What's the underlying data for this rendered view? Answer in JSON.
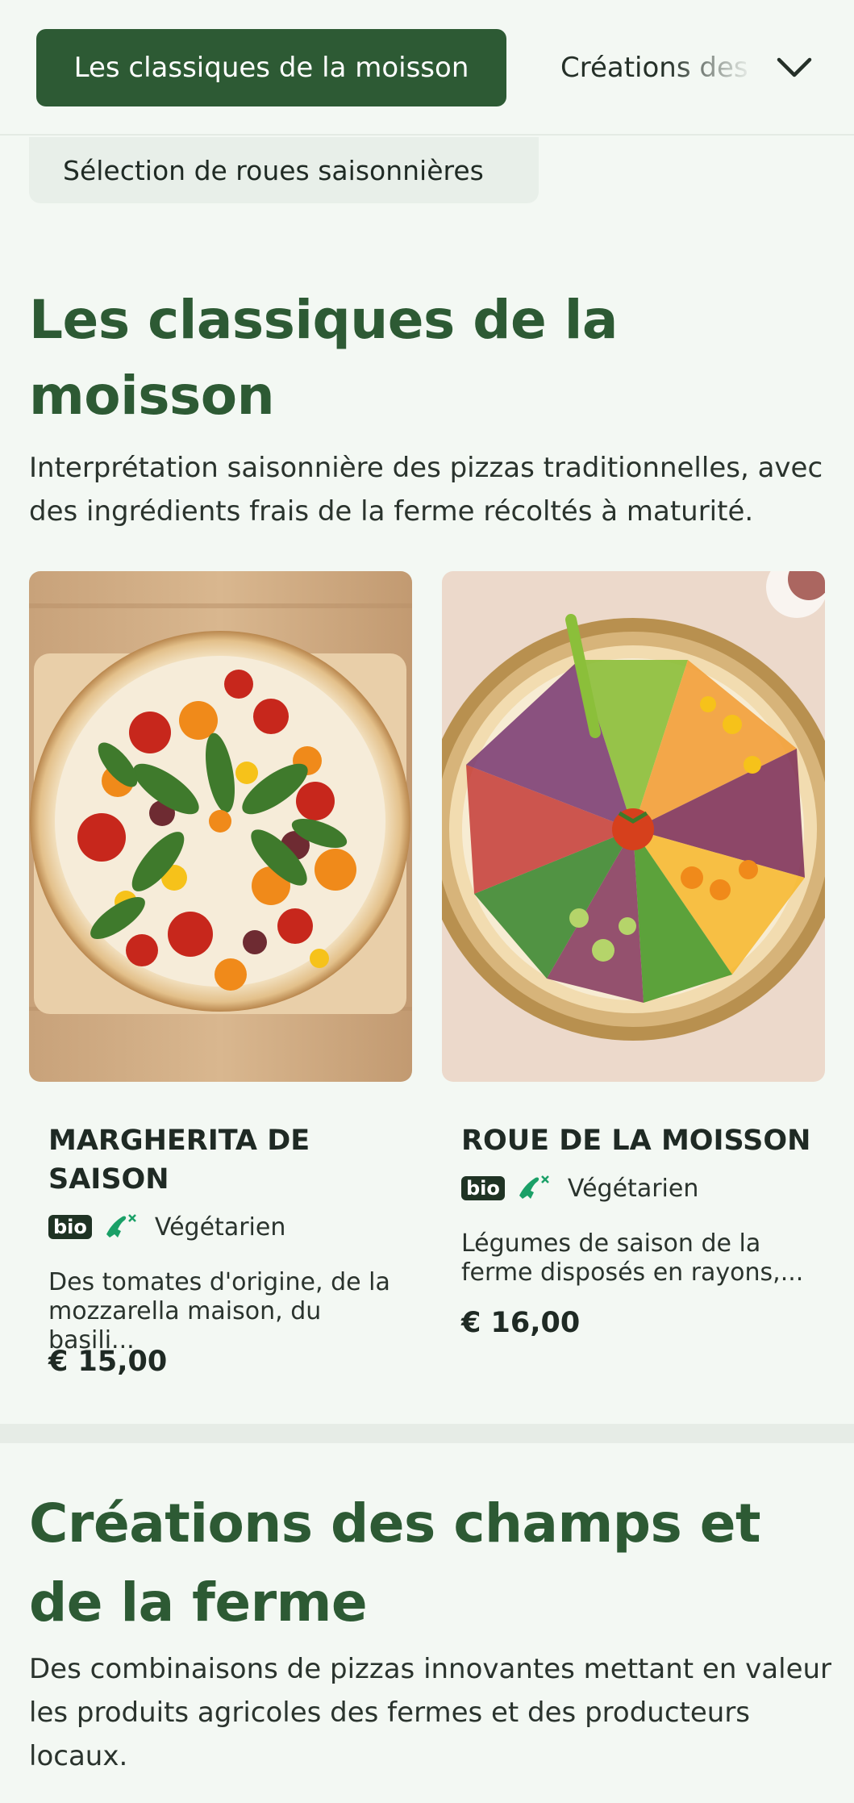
{
  "nav": {
    "active_tab": "Les classiques de la moisson",
    "next_tab": "Créations des champs et de la ferme",
    "expand_icon": "chevron-down-icon"
  },
  "chip": {
    "label": "Sélection de roues saisonnières"
  },
  "section1": {
    "title": "Les classiques de la moisson",
    "description": "Interprétation saisonnière des pizzas traditionnelles, avec des ingrédients frais de la ferme récoltés à maturité."
  },
  "products": [
    {
      "name": "MARGHERITA DE SAISON",
      "badge": "bio",
      "diet": "Végétarien",
      "description": "Des tomates d'origine, de la mozzarella maison, du basili...",
      "price": "€ 15,00"
    },
    {
      "name": "ROUE DE LA MOISSON",
      "badge": "bio",
      "diet": "Végétarien",
      "description": "Légumes de saison de la ferme disposés en rayons,...",
      "price": "€ 16,00"
    }
  ],
  "section2": {
    "title": "Créations des champs et de la ferme",
    "description": "Des combinaisons de pizzas innovantes mettant en valeur les produits agricoles des fermes et des producteurs locaux."
  },
  "colors": {
    "brand_green": "#2d5a34",
    "background": "#f3f8f3",
    "veg_icon": "#1aa067"
  }
}
